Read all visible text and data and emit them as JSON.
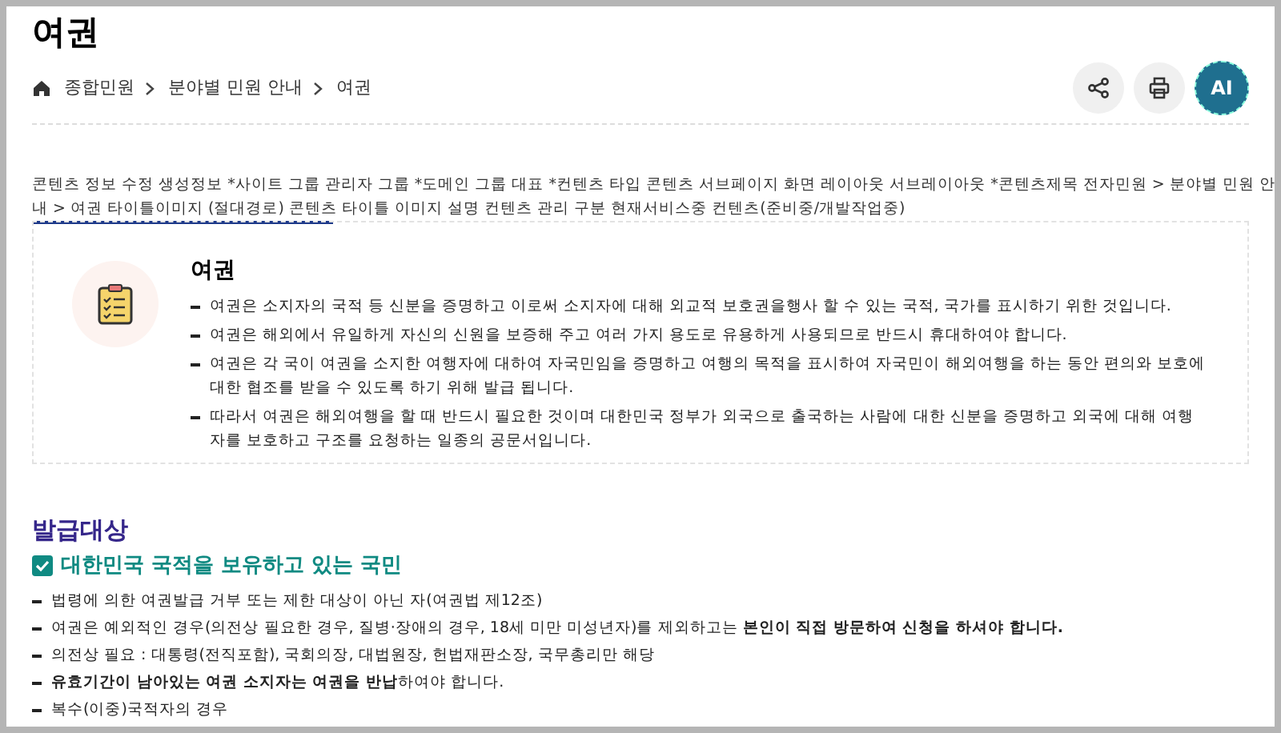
{
  "page_title": "여권",
  "breadcrumb": [
    "종합민원",
    "분야별 민원 안내",
    "여권"
  ],
  "meta_text": "콘텐츠 정보 수정 생성정보 *사이트 그룹 관리자 그룹 *도메인 그룹 대표 *컨텐츠 타입 콘텐츠 서브페이지 화면 레이아웃 서브레이아웃 *콘텐츠제목 전자민원 > 분야별 민원 안내 > 여권 타이틀이미지 (절대경로) 콘텐츠 타이틀 이미지 설명 컨텐츠 관리 구분 현재서비스중 컨텐츠(준비중/개발작업중)",
  "ai_button": "AI",
  "intro_card": {
    "title": "여권",
    "items": [
      "여권은 소지자의 국적 등 신분을 증명하고 이로써 소지자에 대해 외교적 보호권을행사 할 수 있는 국적, 국가를 표시하기 위한 것입니다.",
      "여권은 해외에서 유일하게 자신의 신원을 보증해 주고 여러 가지 용도로 유용하게 사용되므로 반드시 휴대하여야 합니다.",
      "여권은 각 국이 여권을 소지한 여행자에 대하여 자국민임을 증명하고 여행의 목적을 표시하여 자국민이 해외여행을 하는 동안 편의와 보호에 대한 협조를 받을 수 있도록 하기 위해 발급 됩니다.",
      "따라서 여권은 해외여행을 할 때 반드시 필요한 것이며 대한민국 정부가 외국으로 출국하는 사람에 대한 신분을 증명하고 외국에 대해 여행자를 보호하고 구조를 요청하는 일종의 공문서입니다."
    ]
  },
  "section": {
    "title": "발급대상",
    "subtitle": "대한민국 국적을 보유하고 있는 국민",
    "items": [
      "법령에 의한 여권발급 거부 또는 제한 대상이 아닌 자(여권법 제12조)",
      "여권은 예외적인 경우(의전상 필요한 경우, 질병·장애의 경우, 18세 미만 미성년자)를 제외하고는 **본인이 직접 방문하여 신청을 하셔야 합니다.**",
      "의전상 필요 : 대통령(전직포함), 국회의장, 대법원장, 헌법재판소장, 국무총리만 해당",
      "**유효기간이 남아있는 여권 소지자는 여권을 반납**하여야 합니다.",
      "복수(이중)국적자의 경우"
    ]
  }
}
